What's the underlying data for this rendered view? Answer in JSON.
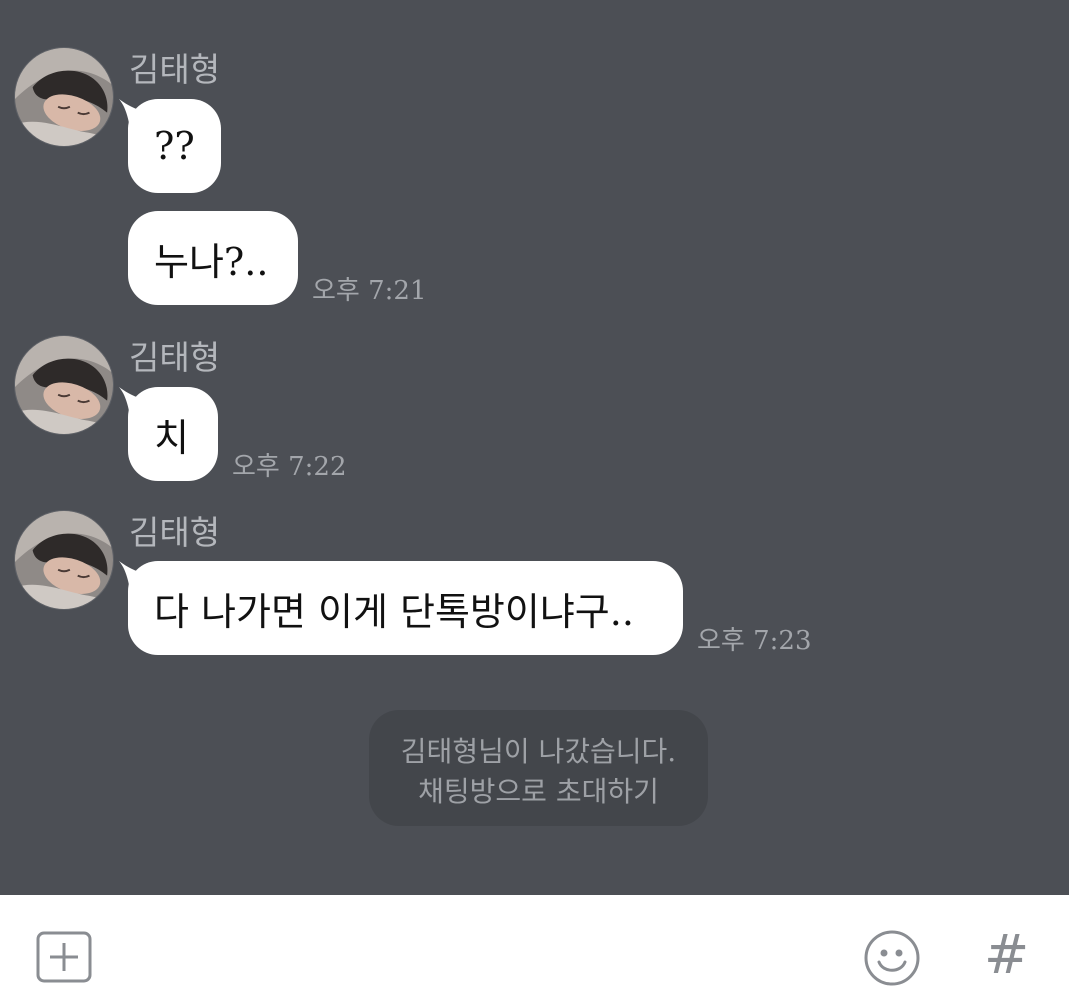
{
  "messages": [
    {
      "sender": "김태형",
      "bubbles": [
        "??",
        "누나?.."
      ],
      "time": "오후 7:21"
    },
    {
      "sender": "김태형",
      "bubbles": [
        "치"
      ],
      "time": "오후 7:22"
    },
    {
      "sender": "김태형",
      "bubbles": [
        "다 나가면 이게 단톡방이냐구.."
      ],
      "time": "오후 7:23"
    }
  ],
  "notice": {
    "text": "김태형님이 나갔습니다.",
    "link": "채팅방으로 초대하기"
  },
  "toolbar": {
    "attach_icon": "plus-square-icon",
    "emoji_icon": "smiley-icon",
    "hashtag_label": "#"
  },
  "colors": {
    "chat_background": "#4c4f55",
    "bubble": "#ffffff",
    "notice_background": "#43464b",
    "toolbar_icon": "#8a8d92"
  }
}
